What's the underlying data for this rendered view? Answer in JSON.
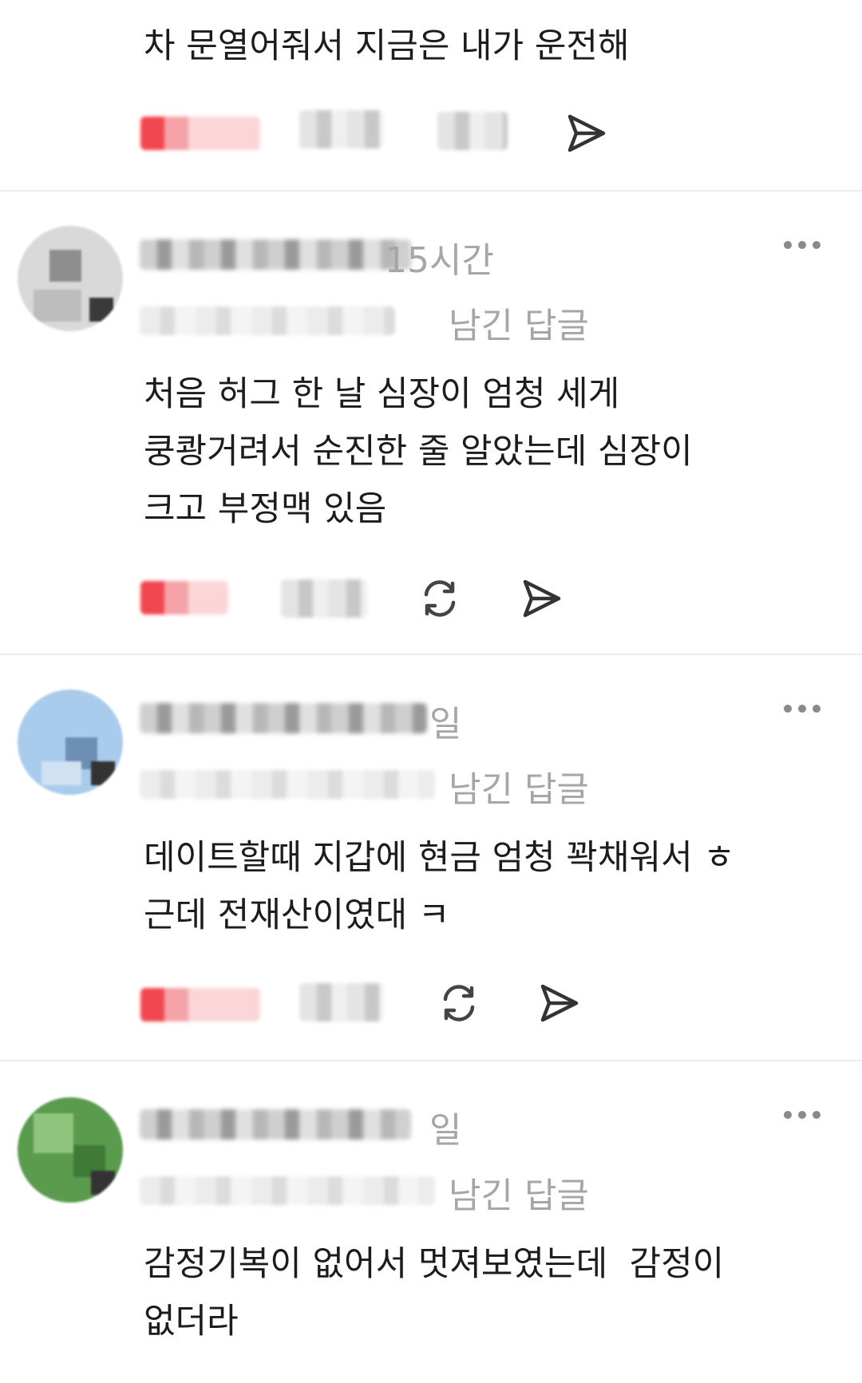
{
  "comments": [
    {
      "text": "차 문열어줘서 지금은 내가 운전해",
      "icons": [
        "like-blurred",
        "count-blurred",
        "count-blurred",
        "send-icon"
      ]
    },
    {
      "time": "15시간",
      "reply_label": "남긴 답글",
      "text": "처음 허그 한 날 심장이 엄청 세게\n쿵쾅거려서 순진한 줄 알았는데 심장이\n크고 부정맥 있음",
      "icons": [
        "like-blurred",
        "count-blurred",
        "repost-icon",
        "send-icon"
      ]
    },
    {
      "time": "일",
      "reply_label": "남긴 답글",
      "text": "데이트할때 지갑에 현금 엄청 꽉채워서 ㅎ\n근데 전재산이였대 ㅋ",
      "icons": [
        "like-blurred",
        "count-blurred",
        "repost-icon",
        "send-icon"
      ]
    },
    {
      "time": "일",
      "reply_label": "남긴 답글",
      "text": "감정기복이 없어서 멋져보였는데  감정이\n없더라"
    }
  ],
  "colors": {
    "like": "#f24650",
    "meta": "#a6a6a6",
    "text": "#1c1c1c",
    "icon": "#333333"
  }
}
